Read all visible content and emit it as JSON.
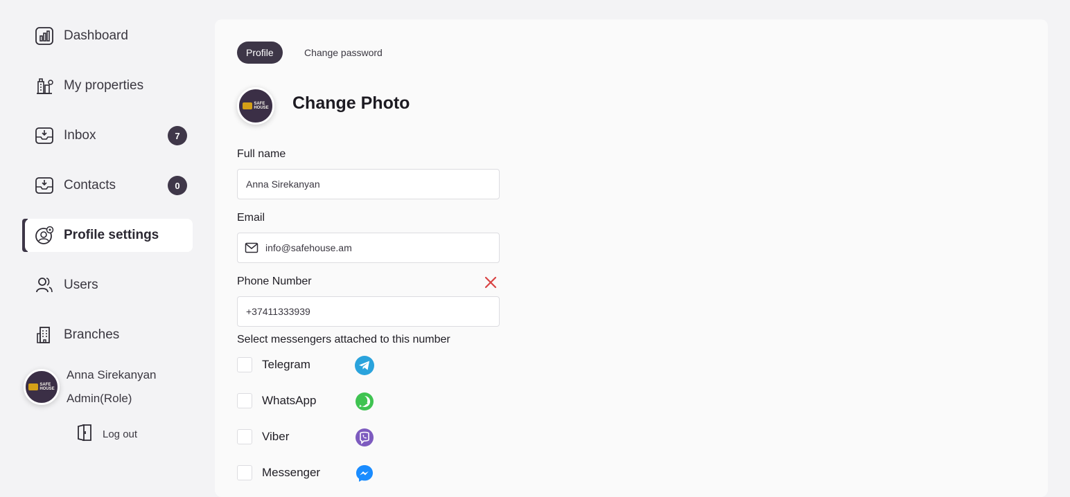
{
  "sidebar": {
    "items": [
      {
        "label": "Dashboard",
        "icon": "dashboard-icon"
      },
      {
        "label": "My properties",
        "icon": "buildings-icon"
      },
      {
        "label": "Inbox",
        "icon": "inbox-icon",
        "badge": "7"
      },
      {
        "label": "Contacts",
        "icon": "contacts-icon",
        "badge": "0"
      },
      {
        "label": "Profile settings",
        "icon": "profile-settings-icon",
        "active": true
      },
      {
        "label": "Users",
        "icon": "users-icon"
      },
      {
        "label": "Branches",
        "icon": "branches-icon"
      }
    ],
    "user": {
      "name": "Anna Sirekanyan",
      "role": "Admin(Role)",
      "logout_label": "Log out",
      "logo_text": "SAFE HOUSE"
    }
  },
  "main": {
    "tabs": [
      {
        "label": "Profile",
        "active": true
      },
      {
        "label": "Change password",
        "active": false
      }
    ],
    "change_photo_label": "Change Photo",
    "form": {
      "full_name_label": "Full name",
      "full_name_value": "Anna Sirekanyan",
      "email_label": "Email",
      "email_value": "info@safehouse.am",
      "phone_label": "Phone Number",
      "phone_value": "+37411333939",
      "messengers_label": "Select messengers attached to this number",
      "messengers": [
        {
          "name": "Telegram",
          "icon": "telegram-icon",
          "checked": false
        },
        {
          "name": "WhatsApp",
          "icon": "whatsapp-icon",
          "checked": false
        },
        {
          "name": "Viber",
          "icon": "viber-icon",
          "checked": false
        },
        {
          "name": "Messenger",
          "icon": "messenger-icon",
          "checked": false
        }
      ]
    }
  },
  "colors": {
    "accent": "#3d3647",
    "background": "#f3f3f5",
    "card": "#fafafa",
    "clear_red": "#d94343",
    "telegram": "#2aa3dc",
    "whatsapp": "#3fc351",
    "viber": "#7d5bbf",
    "messenger": "#1a8cff"
  }
}
